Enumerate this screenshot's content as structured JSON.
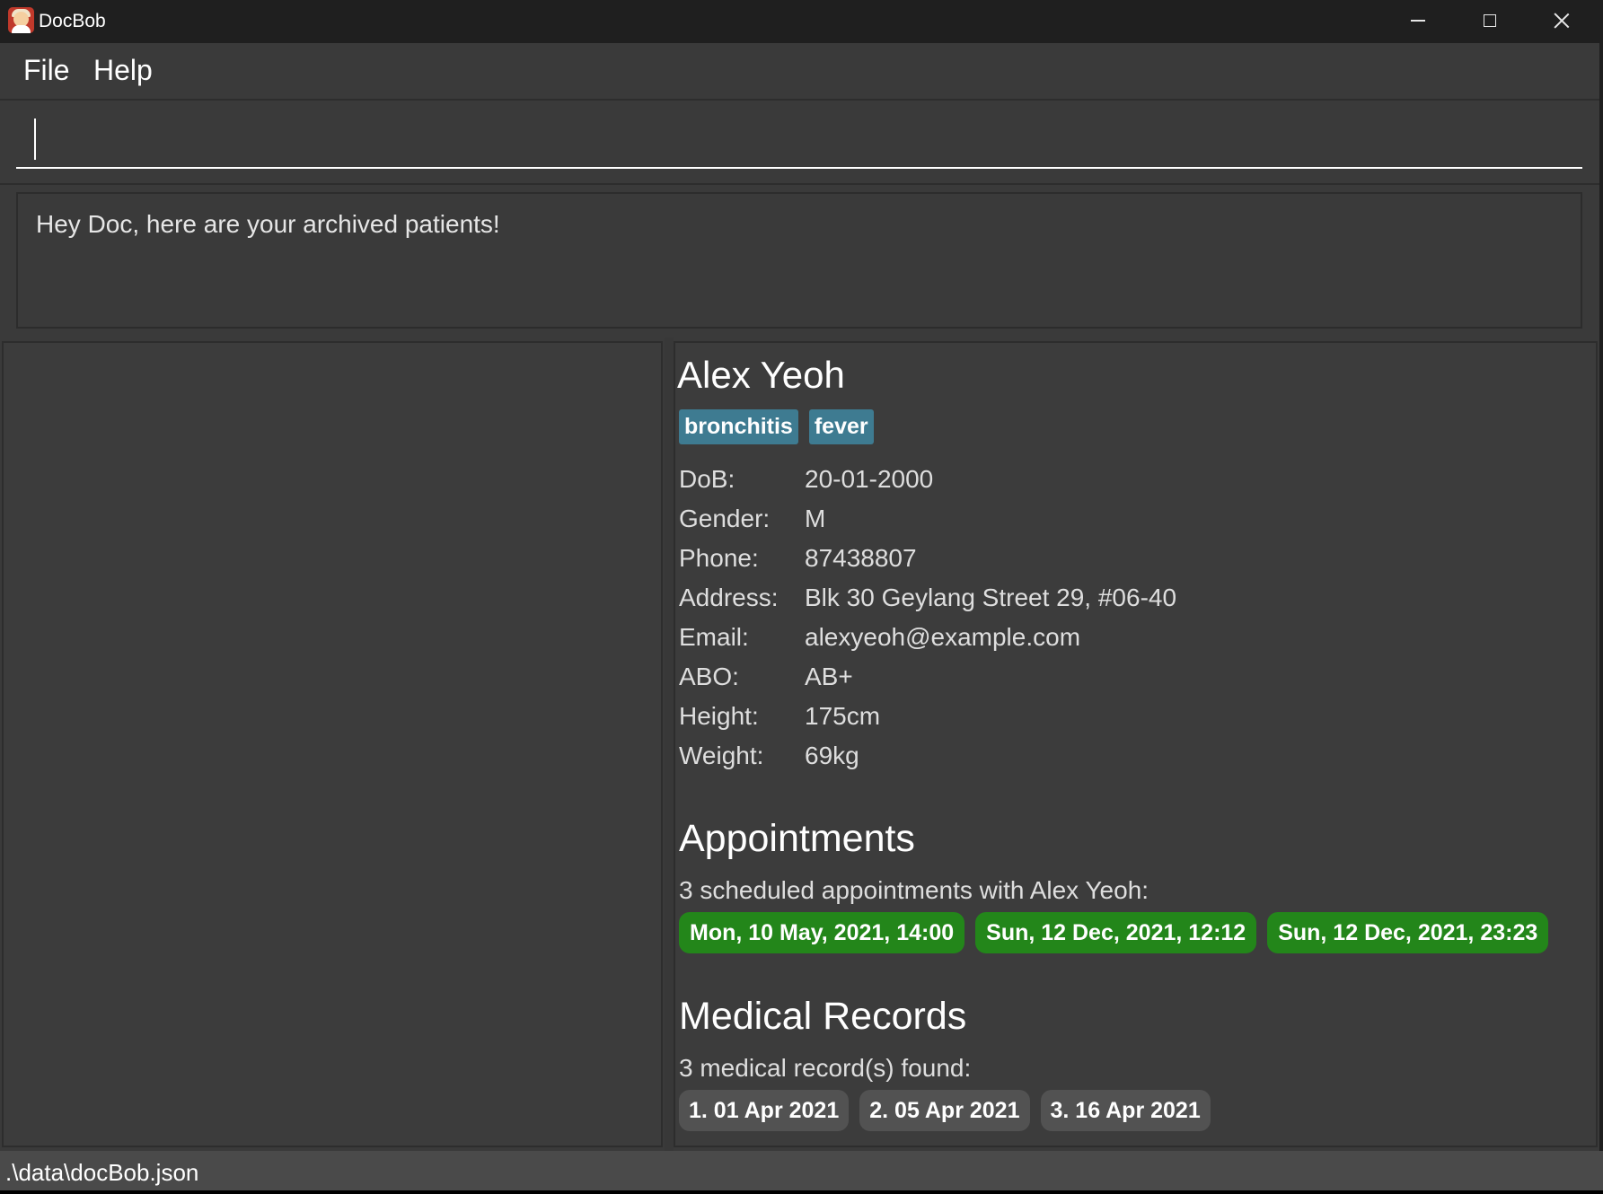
{
  "window": {
    "title": "DocBob",
    "controls": [
      "minimize",
      "maximize",
      "close"
    ]
  },
  "menu": {
    "file": "File",
    "help": "Help"
  },
  "command": {
    "value": ""
  },
  "result": {
    "message": "Hey Doc, here are your archived patients!"
  },
  "patient": {
    "name": "Alex Yeoh",
    "tags": [
      "bronchitis",
      "fever"
    ],
    "details": [
      {
        "label": "DoB:",
        "value": "20-01-2000"
      },
      {
        "label": "Gender:",
        "value": "M"
      },
      {
        "label": "Phone:",
        "value": "87438807"
      },
      {
        "label": "Address:",
        "value": "Blk 30 Geylang Street 29, #06-40"
      },
      {
        "label": "Email:",
        "value": "alexyeoh@example.com"
      },
      {
        "label": "ABO:",
        "value": "AB+"
      },
      {
        "label": "Height:",
        "value": "175cm"
      },
      {
        "label": "Weight:",
        "value": "69kg"
      }
    ]
  },
  "appointments": {
    "title": "Appointments",
    "summary": "3 scheduled appointments with Alex Yeoh:",
    "items": [
      "Mon, 10 May, 2021, 14:00",
      "Sun, 12 Dec, 2021, 12:12",
      "Sun, 12 Dec, 2021, 23:23"
    ],
    "color": "#23861a"
  },
  "records": {
    "title": "Medical Records",
    "summary": "3 medical record(s) found:",
    "items": [
      "1. 01 Apr 2021",
      "2. 05 Apr 2021",
      "3. 16 Apr 2021"
    ]
  },
  "status": {
    "path": ".\\data\\docBob.json"
  }
}
